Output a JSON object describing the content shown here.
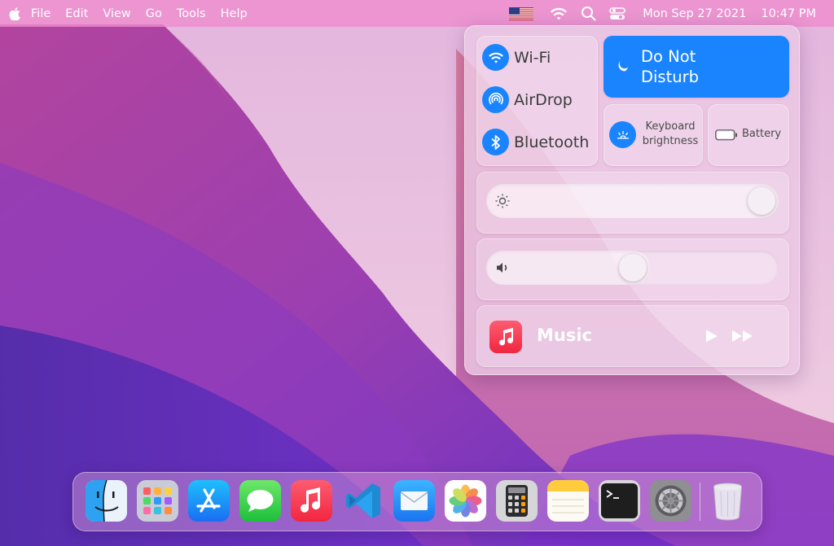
{
  "menubar": {
    "items": [
      "File",
      "Edit",
      "View",
      "Go",
      "Tools",
      "Help"
    ],
    "date": "Mon Sep 27 2021",
    "time": "10:47 PM",
    "icons": [
      "apple-icon",
      "us-flag-icon",
      "wifi-icon",
      "search-icon",
      "control-center-icon"
    ]
  },
  "control_center": {
    "network": {
      "wifi_label": "Wi-Fi",
      "airdrop_label": "AirDrop",
      "bluetooth_label": "Bluetooth"
    },
    "dnd": {
      "line1": "Do Not",
      "line2": "Disturb",
      "active": true
    },
    "keyboard": {
      "line1": "Keyboard",
      "line2": "brightness"
    },
    "battery": {
      "label": "Battery"
    },
    "brightness": {
      "level": 1.0
    },
    "volume": {
      "level": 0.5
    },
    "music": {
      "label": "Music"
    }
  },
  "dock": {
    "apps": [
      "finder",
      "launchpad",
      "app-store",
      "messages",
      "music",
      "vs-code",
      "mail",
      "photos",
      "calculator",
      "notes",
      "terminal",
      "system-preferences",
      "trash"
    ]
  },
  "colors": {
    "accent": "#1a84ff",
    "music_red": "#f1263f"
  }
}
